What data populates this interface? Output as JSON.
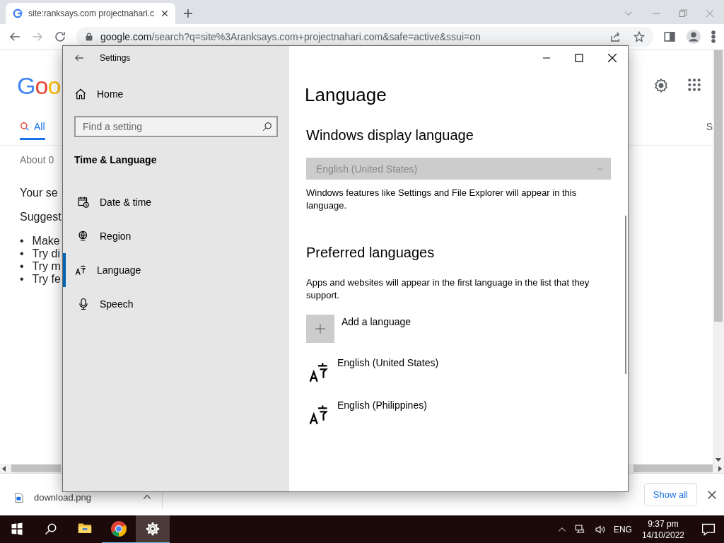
{
  "browser": {
    "tab": {
      "title": "site:ranksays.com projectnahari.c"
    },
    "address": {
      "host": "google.com",
      "path": "/search?q=site%3Aranksays.com+projectnahari.com&safe=active&ssui=on"
    },
    "page": {
      "logo": "Goo",
      "tabs": [
        {
          "label": "All",
          "selected": true
        },
        {
          "label": "S",
          "selected": false
        }
      ],
      "result_stats": "About 0",
      "message": "Your se",
      "suggestions_heading": "Suggest",
      "suggestions": [
        {
          "marker": "•",
          "text": "Make"
        },
        {
          "marker": "•",
          "text": "Try di"
        },
        {
          "marker": "•",
          "text": "Try m"
        },
        {
          "marker": "•",
          "text": "Try fe"
        }
      ]
    },
    "downloads": {
      "file": "download.png",
      "show_all": "Show all"
    }
  },
  "settings": {
    "title": "Settings",
    "home": "Home",
    "search": {
      "placeholder": "Find a setting"
    },
    "section": "Time & Language",
    "nav": [
      {
        "kind": "date",
        "label": "Date & time",
        "selected": false
      },
      {
        "kind": "region",
        "label": "Region",
        "selected": false
      },
      {
        "kind": "language",
        "label": "Language",
        "selected": true
      },
      {
        "kind": "speech",
        "label": "Speech",
        "selected": false
      }
    ],
    "heading": "Language",
    "display": {
      "title": "Windows display language",
      "dropdown": {
        "value": "English (United States)",
        "disabled": true
      },
      "description": "Windows features like Settings and File Explorer will appear in this language."
    },
    "preferred": {
      "title": "Preferred languages",
      "description": "Apps and websites will appear in the first language in the list that they support.",
      "add": "Add a language",
      "languages": [
        "English (United States)",
        "English (Philippines)"
      ]
    }
  },
  "taskbar": {
    "apps": [
      {
        "kind": "explorer",
        "active": false,
        "running": false
      },
      {
        "kind": "chrome",
        "active": false,
        "running": true
      },
      {
        "kind": "settings",
        "active": true,
        "running": true
      }
    ],
    "language": "ENG",
    "time": "9:37 pm",
    "date": "14/10/2022"
  }
}
